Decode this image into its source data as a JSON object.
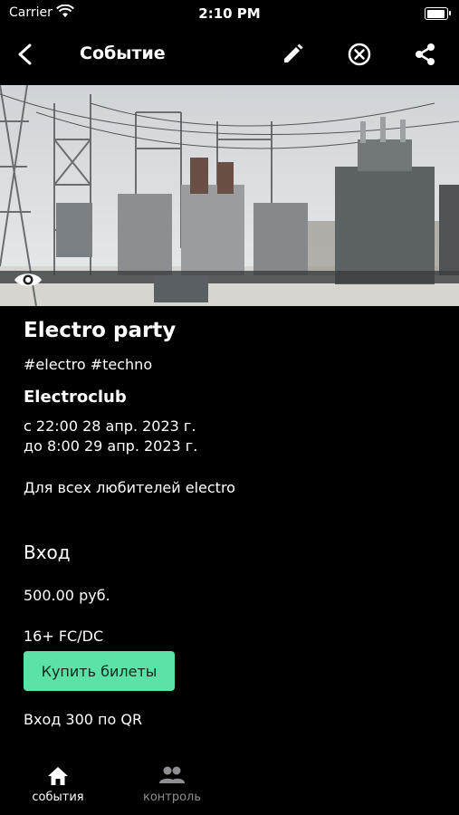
{
  "status_bar": {
    "carrier": "Carrier",
    "time": "2:10 PM"
  },
  "app_bar": {
    "title": "Событие"
  },
  "event": {
    "title": "Electro party",
    "tags": "#electro #techno",
    "venue": "Electroclub",
    "date_from": "с 22:00 28 апр. 2023 г.",
    "date_to": "до 8:00 29 апр. 2023 г.",
    "description": "Для всех любителей electro"
  },
  "entry": {
    "heading": "Вход",
    "price": "500.00 руб.",
    "age_restriction": "16+ FC/DC",
    "buy_label": "Купить билеты",
    "qr_note": "Вход 300 по QR"
  },
  "tabs": [
    {
      "label": "события",
      "icon": "home-icon",
      "active": true
    },
    {
      "label": "контроль",
      "icon": "people-icon",
      "active": false
    }
  ],
  "colors": {
    "background": "#000000",
    "accent": "#5ce1a6",
    "inactive_tab": "#8e8e93"
  }
}
